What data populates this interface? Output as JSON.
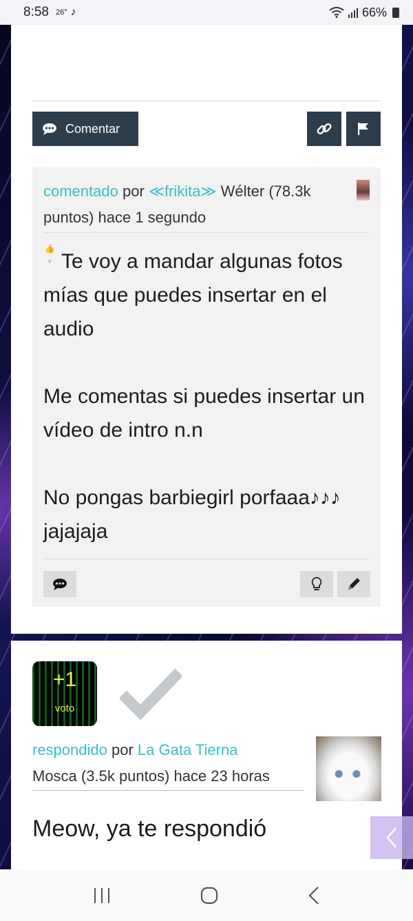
{
  "status": {
    "time": "8:58",
    "temperature": "26°",
    "battery": "66%"
  },
  "actions": {
    "comment_label": "Comentar"
  },
  "comment": {
    "action": "comentado",
    "by": "por",
    "author": "≪frikita≫",
    "level": "Wélter",
    "points": "(78.3k puntos)",
    "time": "hace 1 segundo",
    "paragraphs": [
      "Te voy a mandar algunas fotos mías que puedes insertar en el audio",
      "Me comentas si puedes insertar un vídeo de intro n.n",
      "No pongas barbiegirl porfaaa♪♪♪ jajajaja"
    ]
  },
  "answer": {
    "vote_count": "+1",
    "vote_label": "voto",
    "action": "respondido",
    "by": "por",
    "author": "La Gata Tierna",
    "level": "Mosca",
    "points": "(3.5k puntos)",
    "time": "hace 23 horas",
    "text": "Meow, ya te respondió"
  },
  "colors": {
    "accent": "#39c0c6",
    "button_dark": "#2e3d4c",
    "vote_text": "#e6f23a"
  },
  "icons": {
    "comment": "speech-bubble-icon",
    "link": "link-icon",
    "flag": "flag-icon",
    "lightbulb": "lightbulb-icon",
    "pencil": "pencil-icon",
    "check": "check-icon",
    "back": "chevron-left-icon"
  }
}
